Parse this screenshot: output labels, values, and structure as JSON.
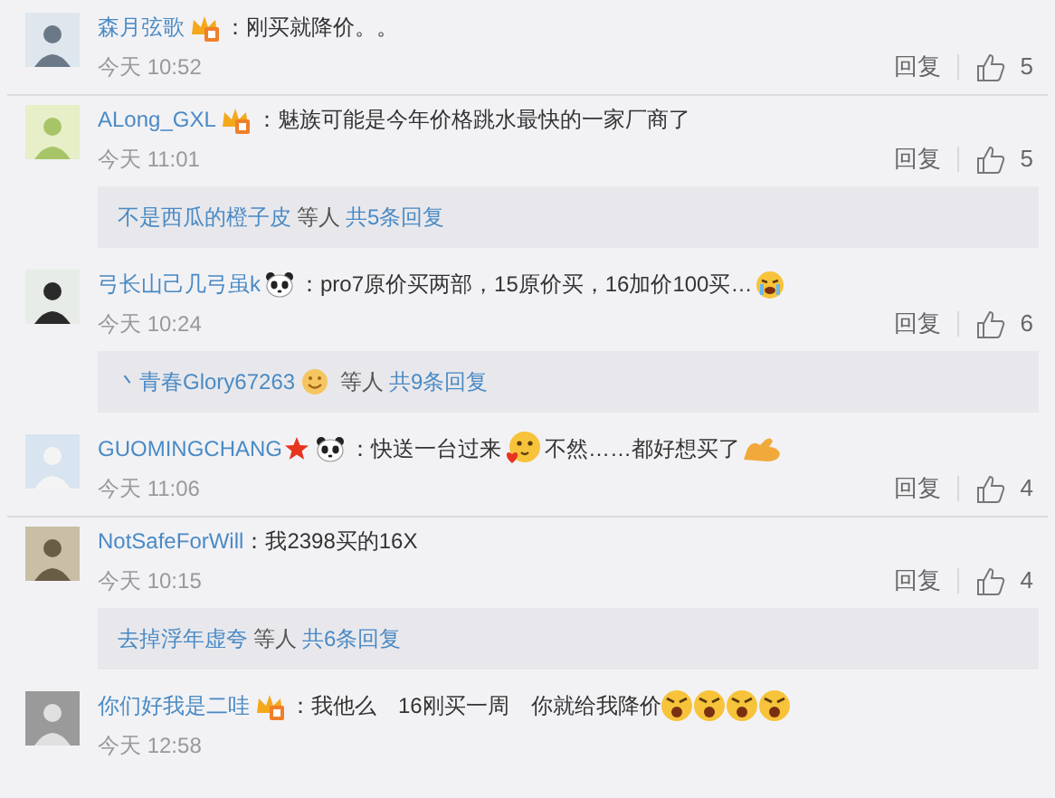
{
  "comments": [
    {
      "name": "森月弦歌",
      "badges": [
        {
          "kind": "crown"
        }
      ],
      "content": [
        {
          "kind": "text",
          "text": "：刚买就降价。。"
        }
      ],
      "time": "今天 10:52",
      "reply_label": "回复",
      "likes": "5"
    },
    {
      "name": "ALong_GXL",
      "badges": [
        {
          "kind": "crown"
        }
      ],
      "content": [
        {
          "kind": "text",
          "text": "：魅族可能是今年价格跳水最快的一家厂商了"
        }
      ],
      "time": "今天 11:01",
      "reply_label": "回复",
      "likes": "5",
      "replies": {
        "names": "不是西瓜的橙子皮",
        "others": "等人",
        "count": "共5条回复"
      }
    },
    {
      "name": "弓长山己几弓虽k",
      "badges": [
        {
          "kind": "panda"
        }
      ],
      "content": [
        {
          "kind": "text",
          "text": "：pro7原价买两部，15原价买，16加价100买…"
        },
        {
          "kind": "cry"
        }
      ],
      "time": "今天 10:24",
      "reply_label": "回复",
      "likes": "6",
      "replies": {
        "names": "丶青春Glory67263",
        "name_badges": [
          {
            "kind": "smile"
          }
        ],
        "others": "等人",
        "count": "共9条回复"
      }
    },
    {
      "name": "GUOMINGCHANG",
      "badges": [
        {
          "kind": "star"
        },
        {
          "kind": "panda"
        }
      ],
      "content": [
        {
          "kind": "text",
          "text": "：快送一台过来"
        },
        {
          "kind": "kiss"
        },
        {
          "kind": "text",
          "text": "不然……都好想买了"
        },
        {
          "kind": "arm"
        }
      ],
      "time": "今天 11:06",
      "reply_label": "回复",
      "likes": "4"
    },
    {
      "name": "NotSafeForWill",
      "content": [
        {
          "kind": "text",
          "text": "：我2398买的16X"
        }
      ],
      "time": "今天 10:15",
      "reply_label": "回复",
      "likes": "4",
      "replies": {
        "names": "去掉浮年虚夸",
        "others": "等人",
        "count": "共6条回复"
      }
    },
    {
      "name": "你们好我是二哇",
      "badges": [
        {
          "kind": "crown"
        }
      ],
      "content": [
        {
          "kind": "text",
          "text": "：我他么　16刚买一周　你就给我降价"
        },
        {
          "kind": "angry"
        },
        {
          "kind": "angry"
        },
        {
          "kind": "angry"
        },
        {
          "kind": "angry"
        }
      ],
      "time": "今天 12:58"
    }
  ]
}
